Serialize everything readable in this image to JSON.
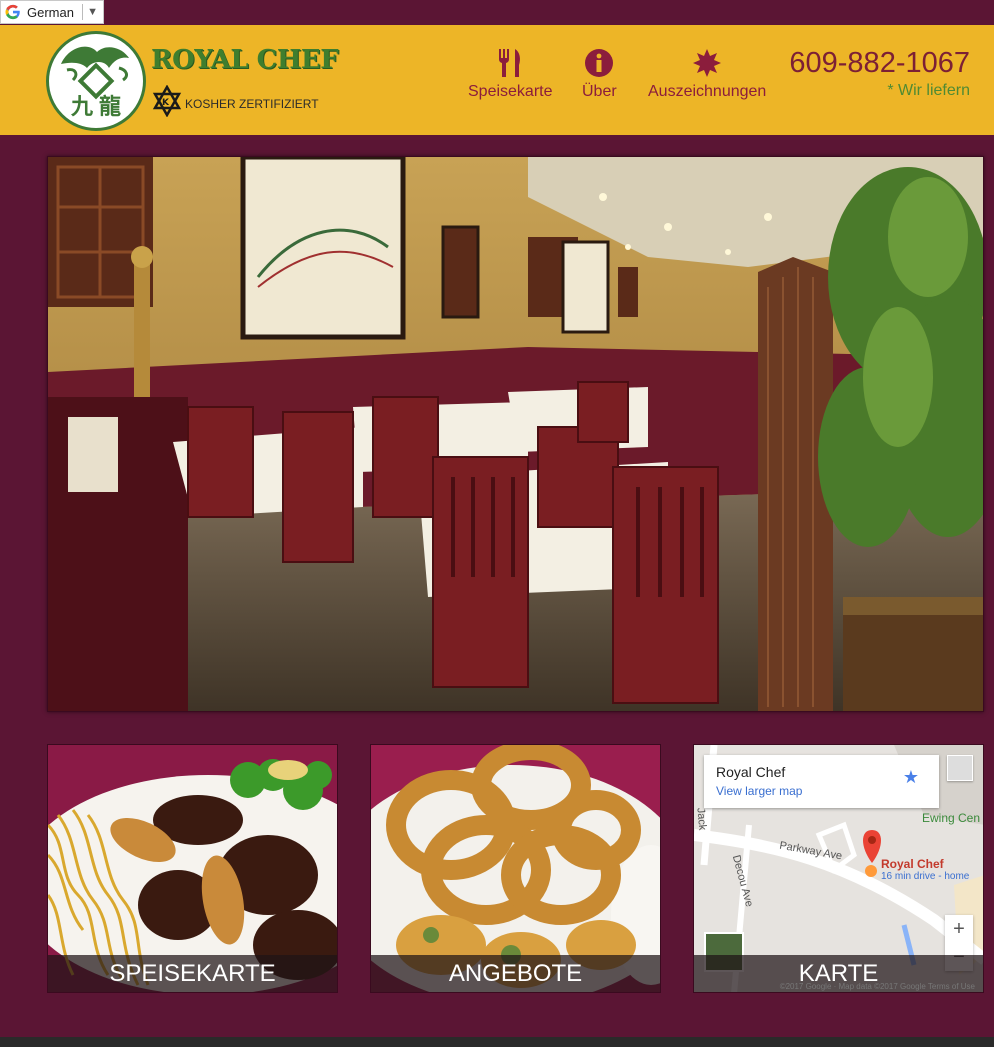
{
  "translate_bar": {
    "language": "German",
    "arrow": "▼"
  },
  "header": {
    "brand": "ROYAL CHEF",
    "kosher_label": "KOSHER ZERTIFIZIERT",
    "nav": [
      {
        "label": "Speisekarte",
        "icon": "fork-knife-icon"
      },
      {
        "label": "Über",
        "icon": "info-icon"
      },
      {
        "label": "Auszeichnungen",
        "icon": "award-icon"
      }
    ],
    "phone": "609-882-1067",
    "delivery": "* Wir liefern"
  },
  "tiles": [
    {
      "label": "SPEISEKARTE"
    },
    {
      "label": "ANGEBOTE"
    },
    {
      "label": "KARTE"
    }
  ],
  "map": {
    "card_title": "Royal Chef",
    "card_link": "View larger map",
    "streets": {
      "parkway": "Parkway Ave",
      "decou": "Decou Ave",
      "jack": "Jack",
      "ewing": "Ewing Cen"
    },
    "pin_label": "Royal Chef",
    "pin_sub": "16 min drive - home",
    "zoom_in": "+",
    "zoom_out": "−",
    "footer": "©2017 Google · Map data ©2017 Google   Terms of Use"
  },
  "colors": {
    "header_bg": "#edb527",
    "page_bg": "#5b1534",
    "brand_green": "#3f7e2e",
    "nav_red": "#8b1d3c"
  }
}
